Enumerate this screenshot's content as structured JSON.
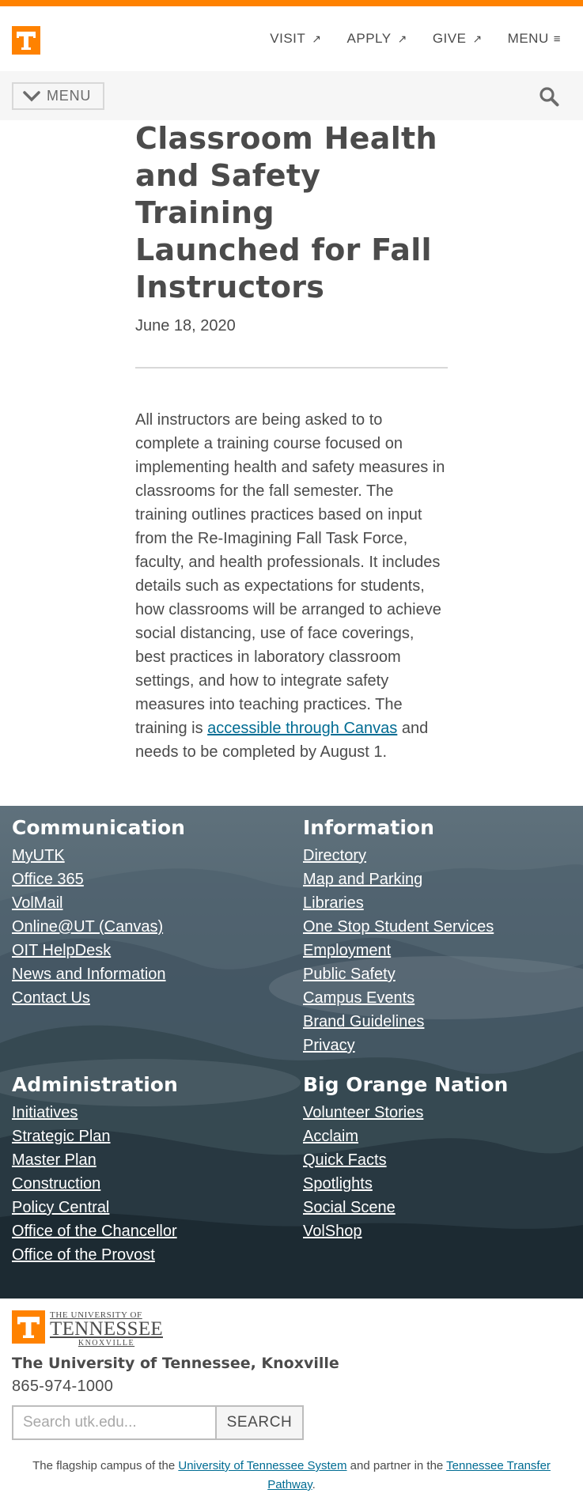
{
  "colors": {
    "brand_orange": "#ff8200",
    "text": "#4b4b4b",
    "link": "#006c93",
    "footer_bg": "#2b3e4a"
  },
  "header": {
    "logo_icon": "power-t-logo",
    "nav": [
      {
        "label": "VISIT",
        "icon": "external-arrow-icon",
        "glyph": "↗"
      },
      {
        "label": "APPLY",
        "icon": "external-arrow-icon",
        "glyph": "↗"
      },
      {
        "label": "GIVE",
        "icon": "external-arrow-icon",
        "glyph": "↗"
      },
      {
        "label": "MENU",
        "icon": "hamburger-icon",
        "glyph": "≡"
      }
    ]
  },
  "subnav": {
    "menu_label": "MENU",
    "menu_icon": "chevron-down-icon",
    "search_icon": "search-icon"
  },
  "article": {
    "title": "Classroom Health and Safety Training Launched for Fall Instructors",
    "date": "June 18, 2020",
    "body_before_link": "All instructors are being asked to to complete a training course focused on implementing health and safety measures in classrooms for the fall semester. The training outlines practices based on input from the Re-Imagining Fall Task Force, faculty, and health professionals. It includes details such as expectations for students, how classrooms will be arranged to achieve social distancing, use of face coverings, best practices in laboratory classroom settings, and how to integrate safety measures into teaching practices. The training is ",
    "link_text": "accessible through Canvas",
    "body_after_link": " and needs to be completed by August 1."
  },
  "footer": {
    "communication": {
      "heading": "Communication",
      "links": [
        "MyUTK",
        "Office 365",
        "VolMail",
        "Online@UT (Canvas)",
        "OIT HelpDesk",
        "News and Information",
        "Contact Us"
      ]
    },
    "information": {
      "heading": "Information",
      "links": [
        "Directory",
        "Map and Parking",
        "Libraries",
        "One Stop Student Services",
        "Employment",
        "Public Safety",
        "Campus Events",
        "Brand Guidelines",
        "Privacy"
      ]
    },
    "administration": {
      "heading": "Administration",
      "links": [
        "Initiatives",
        "Strategic Plan",
        "Master Plan",
        "Construction",
        "Policy Central",
        "Office of the Chancellor",
        "Office of the Provost"
      ]
    },
    "big_orange_nation": {
      "heading": "Big Orange Nation",
      "links": [
        "Volunteer Stories",
        "Acclaim",
        "Quick Facts",
        "Spotlights",
        "Social Scene",
        "VolShop"
      ]
    }
  },
  "bottom": {
    "logo": {
      "line1": "THE UNIVERSITY OF",
      "line2": "TENNESSEE",
      "line3": "KNOXVILLE"
    },
    "campus_name": "The University of Tennessee, Knoxville",
    "phone": "865-974-1000",
    "search_placeholder": "Search utk.edu...",
    "search_button": "SEARCH",
    "flagship_prefix": "The flagship campus of the ",
    "flagship_link1": "University of Tennessee System",
    "flagship_middle": " and partner in the ",
    "flagship_link2": "Tennessee Transfer Pathway",
    "flagship_suffix": "."
  }
}
